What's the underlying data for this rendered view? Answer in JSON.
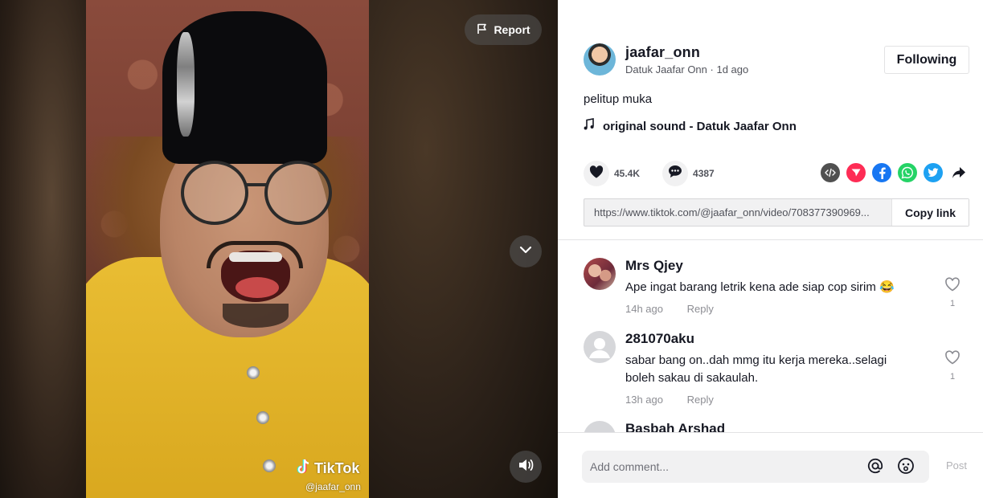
{
  "video": {
    "report_label": "Report",
    "watermark_brand": "TikTok",
    "watermark_user": "@jaafar_onn"
  },
  "author": {
    "username": "jaafar_onn",
    "display_name": "Datuk Jaafar Onn",
    "posted": "1d ago",
    "follow_label": "Following"
  },
  "post": {
    "caption": "pelitup muka",
    "sound": "original sound - Datuk Jaafar Onn",
    "likes": "45.4K",
    "comments": "4387",
    "link": "https://www.tiktok.com/@jaafar_onn/video/708377390969...",
    "copy_label": "Copy link"
  },
  "share_icons": [
    "embed-icon",
    "send-icon",
    "facebook-icon",
    "whatsapp-icon",
    "twitter-icon",
    "share-arrow-icon"
  ],
  "comments": [
    {
      "name": "Mrs Qjey",
      "text": "Ape ingat barang letrik kena ade siap cop sirim 😂",
      "time": "14h ago",
      "reply": "Reply",
      "likes": "1"
    },
    {
      "name": "281070aku",
      "text": "sabar bang on..dah mmg itu kerja mereka..selagi boleh sakau di sakaulah.",
      "time": "13h ago",
      "reply": "Reply",
      "likes": "1"
    },
    {
      "name": "Basbah Arshad"
    }
  ],
  "composer": {
    "placeholder": "Add comment...",
    "post_label": "Post"
  },
  "colors": {
    "tiktok_red": "#FE2C55",
    "facebook": "#1877F2",
    "whatsapp": "#25D366",
    "twitter": "#1DA1F2",
    "embed": "#505050"
  }
}
